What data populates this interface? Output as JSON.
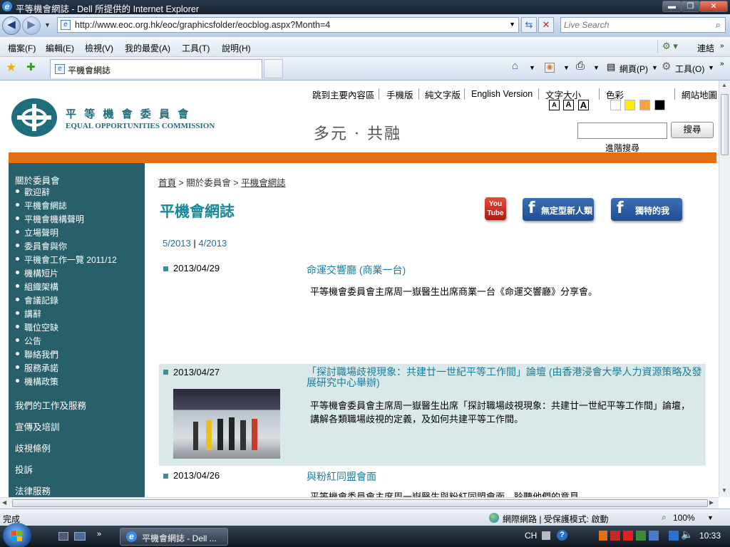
{
  "window": {
    "title": "平等機會網誌 - Dell 所提供的 Internet Explorer",
    "minimize": "▬",
    "maximize": "❐",
    "close": "✕"
  },
  "address": {
    "url": "http://www.eoc.org.hk/eoc/graphicsfolder/eocblog.aspx?Month=4",
    "search_placeholder": "Live Search"
  },
  "menu": {
    "items": [
      "檔案(F)",
      "編輯(E)",
      "檢視(V)",
      "我的最愛(A)",
      "工具(T)",
      "說明(H)"
    ],
    "links": "連結"
  },
  "tabbar": {
    "tab_title": "平機會網誌",
    "page": "網頁(P)",
    "tools": "工具(O)"
  },
  "site": {
    "logo_cn": "平 等 機 會 委 員 會",
    "logo_en": "EQUAL OPPORTUNITIES COMMISSION",
    "slogan": "多元 · 共融",
    "top_links": [
      "跳到主要內容區",
      "手機版",
      "純文字版",
      "English Version",
      "文字大小",
      "色彩",
      "網站地圖"
    ],
    "font_sizes": [
      "A",
      "A",
      "A"
    ],
    "colors": [
      "#ffffff",
      "#ffff00",
      "#f7a040",
      "#000000"
    ],
    "search_button": "搜尋",
    "advanced_search": "進階搜尋"
  },
  "sidebar": {
    "heading": "關於委員會",
    "items": [
      "歡迎辭",
      "平機會網誌",
      "平機會機構聲明",
      "立場聲明",
      "委員會與你",
      "平機會工作一覽 2011/12",
      "機構短片",
      "組織架構",
      "會議記錄",
      "講辭",
      "職位空缺",
      "公告",
      "聯絡我們",
      "服務承諾",
      "機構政策"
    ],
    "sections": [
      "我們的工作及服務",
      "宣傳及培訓",
      "歧視條例",
      "投訴",
      "法律服務"
    ]
  },
  "main": {
    "breadcrumb": [
      "首頁",
      ">",
      "關於委員會",
      ">",
      "平機會網誌"
    ],
    "page_title": "平機會網誌",
    "social": [
      "You Tube",
      "無定型新人類",
      "獨特的我"
    ],
    "months": [
      "5/2013",
      "|",
      "4/2013"
    ],
    "entries": [
      {
        "date": "2013/04/29",
        "title": "命運交響廳 (商業一台)",
        "desc": "平等機會委員會主席周一嶽醫生出席商業一台《命運交響廳》分享會。"
      },
      {
        "date": "2013/04/27",
        "title": "「探討職場歧視現象：共建廿一世紀平等工作間」論壇 (由香港浸會大學人力資源策略及發展研究中心舉辦)",
        "desc": "平等機會委員會主席周一嶽醫生出席「探討職場歧視現象：共建廿一世紀平等工作間」論壇，講解各類職場歧視的定義，及如何共建平等工作間。"
      },
      {
        "date": "2013/04/26",
        "title": "與粉紅同盟會面",
        "desc": "平等機會委員會主席周一嶽醫生與粉紅同盟會面，聆聽他們的意見。"
      }
    ]
  },
  "status": {
    "text": "完成",
    "zone": "網際網路 | 受保護模式: 啟動",
    "zoom": "100%"
  },
  "taskbar": {
    "task": "平機會網誌 - Dell ...",
    "lang": "CH",
    "clock": "10:33"
  }
}
